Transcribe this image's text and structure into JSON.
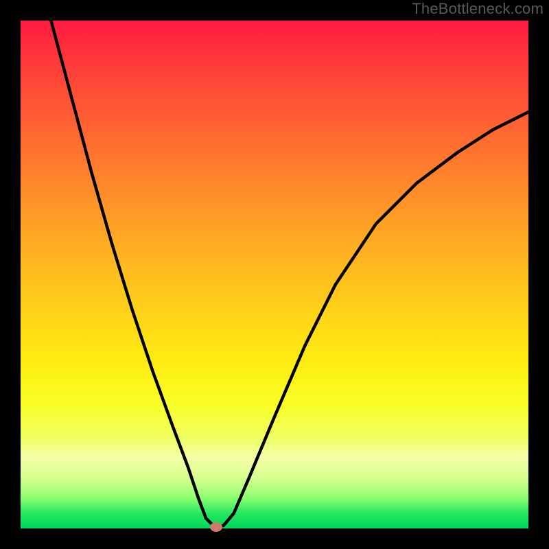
{
  "watermark": "TheBottleneck.com",
  "chart_data": {
    "type": "line",
    "title": "",
    "xlabel": "",
    "ylabel": "",
    "xlim": [
      0,
      100
    ],
    "ylim": [
      0,
      100
    ],
    "grid": false,
    "legend": false,
    "series": [
      {
        "name": "curve",
        "x": [
          6,
          10,
          14,
          18,
          22,
          26,
          30,
          33,
          35,
          36.5,
          38,
          39,
          40,
          42,
          45,
          50,
          56,
          62,
          70,
          78,
          86,
          93,
          100
        ],
        "values": [
          100,
          85,
          70,
          56,
          43,
          31,
          20,
          12,
          6,
          2,
          0.5,
          0.3,
          0.6,
          3,
          10,
          22,
          36,
          48,
          60,
          68,
          74,
          78.5,
          82
        ]
      }
    ],
    "marker": {
      "x": 38.5,
      "y": 0.3
    },
    "colors": {
      "curve": "#000000",
      "marker": "#cf7b6c",
      "gradient_top": "#ff1a3f",
      "gradient_bottom": "#00d659"
    }
  }
}
